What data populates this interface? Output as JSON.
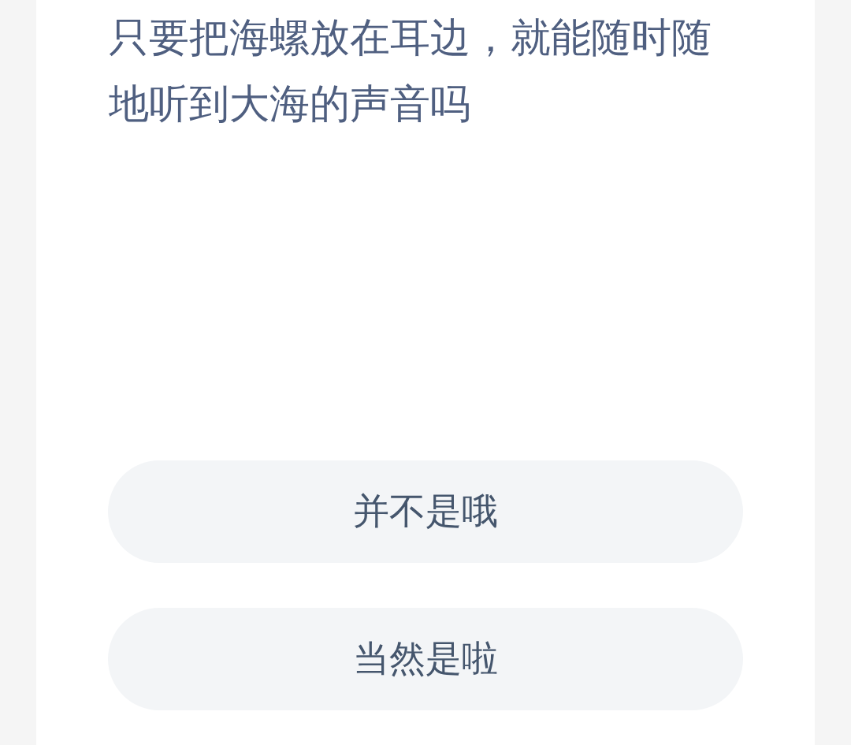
{
  "question": "只要把海螺放在耳边，就能随时随地听到大海的声音吗",
  "options": [
    {
      "label": "并不是哦"
    },
    {
      "label": "当然是啦"
    }
  ]
}
